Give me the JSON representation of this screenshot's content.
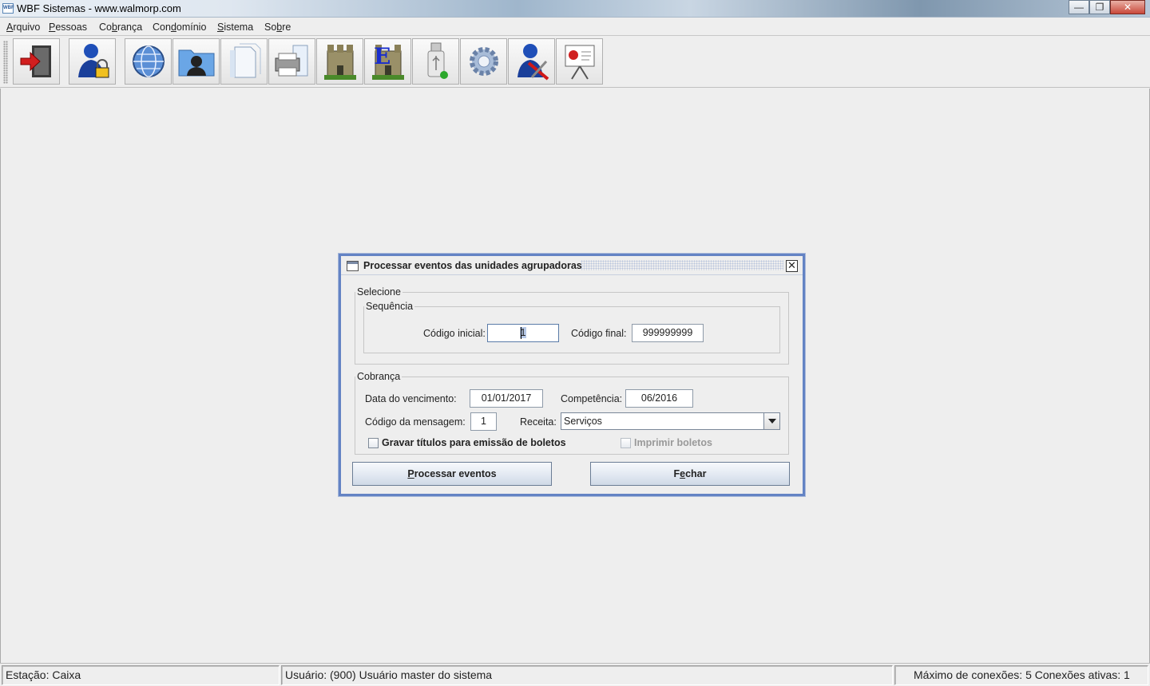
{
  "window": {
    "title": "WBF Sistemas - www.walmorp.com",
    "icon_text": "WBF",
    "minimize_glyph": "—",
    "maximize_glyph": "❐",
    "close_glyph": "✕"
  },
  "menu": {
    "items": [
      {
        "mnemonic": "A",
        "rest": "rquivo"
      },
      {
        "mnemonic": "P",
        "rest": "essoas"
      },
      {
        "pre": "Co",
        "mnemonic": "b",
        "rest": "rança"
      },
      {
        "pre": "Con",
        "mnemonic": "d",
        "rest": "omínio"
      },
      {
        "mnemonic": "S",
        "rest": "istema"
      },
      {
        "pre": "So",
        "mnemonic": "b",
        "rest": "re"
      }
    ]
  },
  "toolbar": {
    "buttons": [
      "exit-door-icon",
      "user-lock-icon",
      "globe-icon",
      "contacts-folder-icon",
      "documents-icon",
      "printer-icon",
      "castle-icon",
      "castle-e-icon",
      "usb-drive-icon",
      "gear-icon",
      "user-tools-icon",
      "presentation-board-icon"
    ],
    "castle_letter": "E"
  },
  "dialog": {
    "title": "Processar eventos das unidades agrupadoras",
    "close_glyph": "✕",
    "selecione": {
      "legend": "Selecione",
      "sequencia": {
        "legend": "Sequência",
        "codigo_inicial_label": "Código inicial:",
        "codigo_inicial_value": "1",
        "codigo_final_label": "Código final:",
        "codigo_final_value": "999999999"
      }
    },
    "cobranca": {
      "legend": "Cobrança",
      "data_vencimento_label": "Data do vencimento:",
      "data_vencimento_value": "01/01/2017",
      "competencia_label": "Competência:",
      "competencia_value": "06/2016",
      "codigo_mensagem_label": "Código da mensagem:",
      "codigo_mensagem_value": "1",
      "receita_label": "Receita:",
      "receita_value": "Serviços",
      "gravar_titulos_label": "Gravar títulos para emissão de boletos",
      "gravar_titulos_checked": false,
      "imprimir_boletos_label": "Imprimir boletos",
      "imprimir_boletos_checked": false,
      "imprimir_boletos_enabled": false
    },
    "buttons": {
      "processar": {
        "mnemonic": "P",
        "rest": "rocessar eventos"
      },
      "fechar": {
        "pre": "F",
        "mnemonic": "e",
        "rest": "char"
      }
    }
  },
  "status": {
    "estacao": "Estação: Caixa",
    "usuario": "Usuário: (900) Usuário master do sistema",
    "conexoes": "Máximo de conexões: 5 Conexões ativas: 1"
  },
  "colors": {
    "dialog_border": "#6383c4",
    "background": "#eeeeee"
  }
}
